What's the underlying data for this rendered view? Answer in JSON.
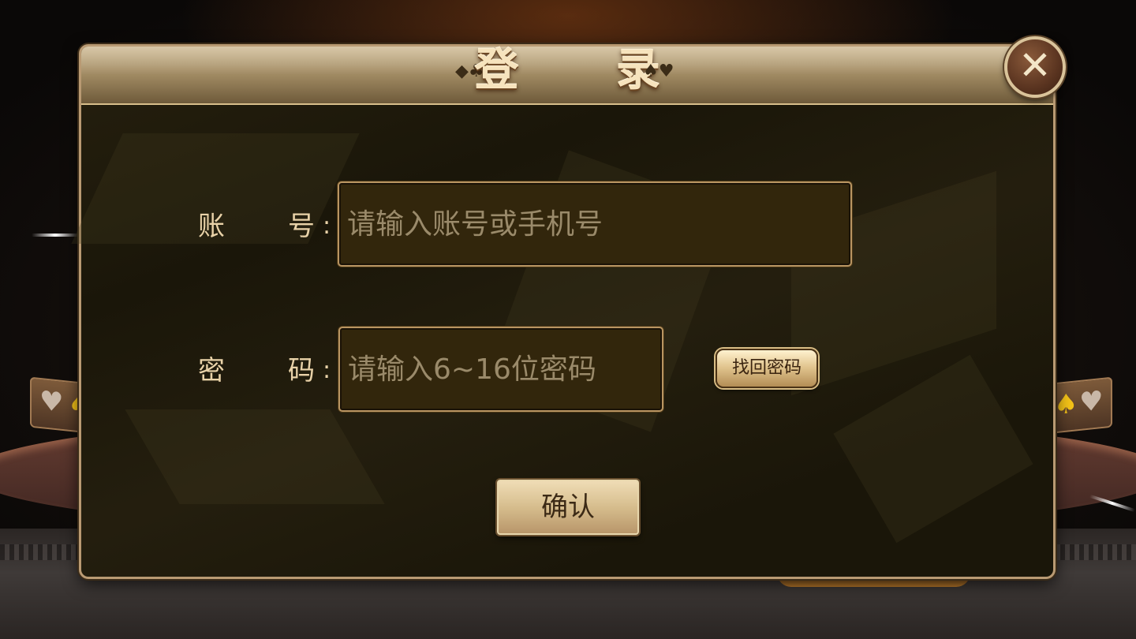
{
  "dialog": {
    "title": "登 录",
    "title_deco_left": "◆♣",
    "title_deco_right": "♠♥",
    "close_label": "✕"
  },
  "form": {
    "account": {
      "label_left": "账",
      "label_right": "号",
      "colon": ":",
      "placeholder": "请输入账号或手机号",
      "value": ""
    },
    "password": {
      "label_left": "密",
      "label_right": "码",
      "colon": ":",
      "placeholder": "请输入6~16位密码",
      "value": ""
    },
    "forgot_password_label": "找回密码",
    "confirm_label": "确认"
  },
  "background": {
    "left_badge_suits": [
      "♥",
      "♠"
    ],
    "right_badge_suits": [
      "♠",
      "♥"
    ]
  }
}
